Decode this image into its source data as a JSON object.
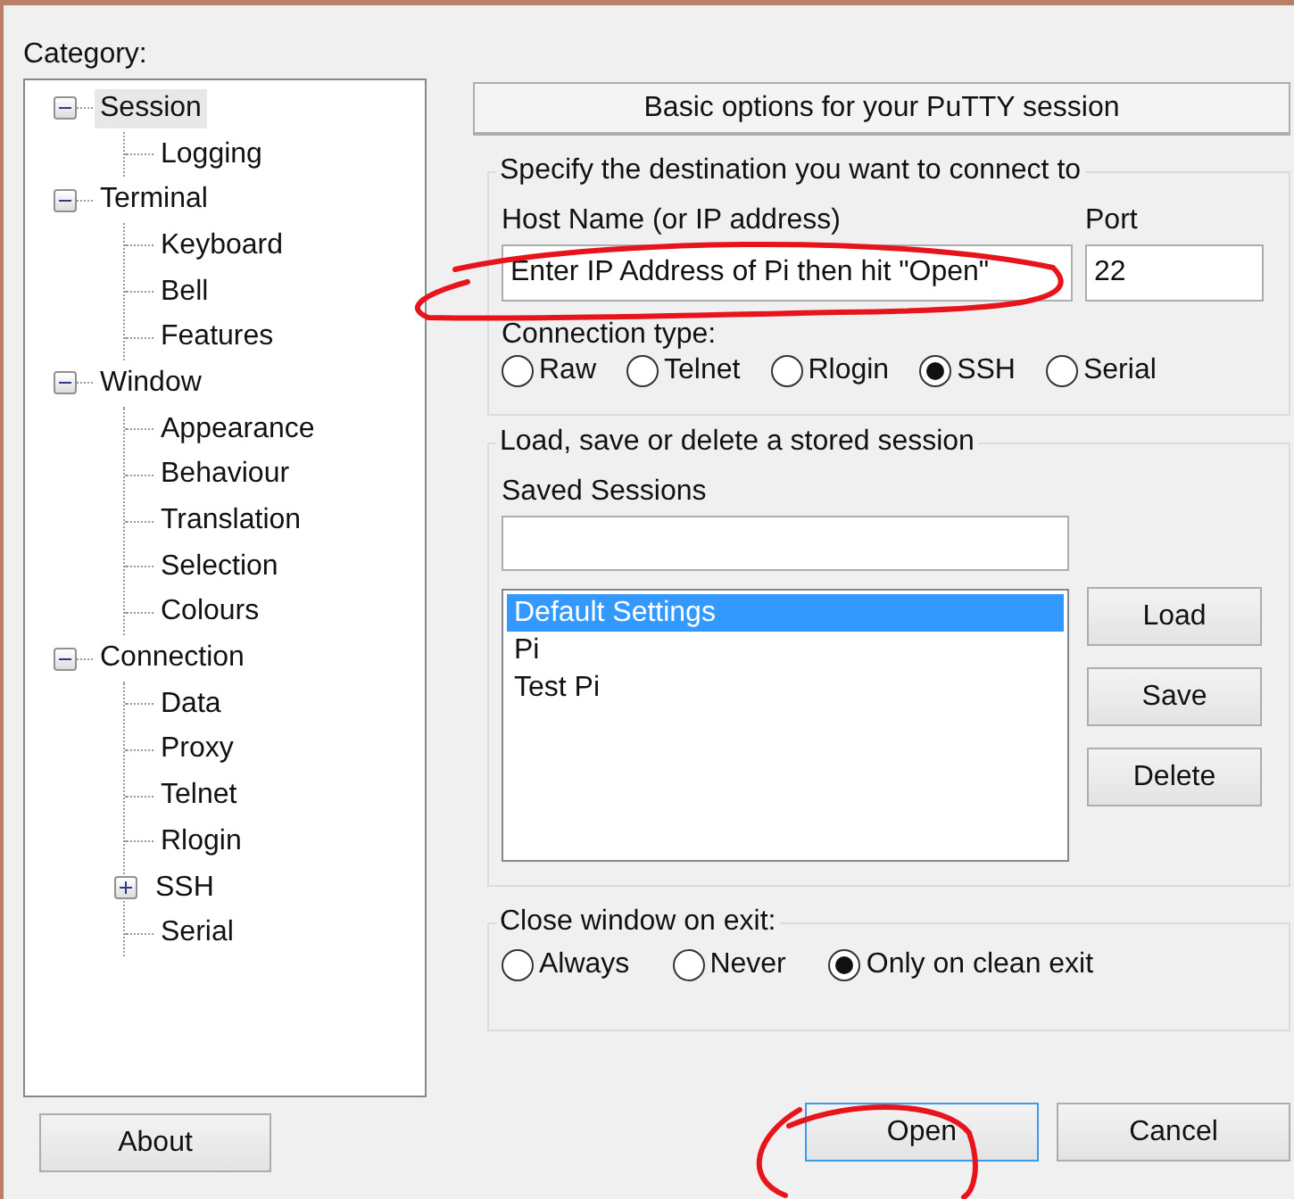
{
  "category_label": "Category:",
  "tree": [
    {
      "label": "Session",
      "expanded": true,
      "selected": true,
      "children": [
        {
          "label": "Logging",
          "selected": false
        }
      ]
    },
    {
      "label": "Terminal",
      "expanded": true,
      "selected": false,
      "children": [
        {
          "label": "Keyboard",
          "selected": false
        },
        {
          "label": "Bell",
          "selected": false
        },
        {
          "label": "Features",
          "selected": false
        }
      ]
    },
    {
      "label": "Window",
      "expanded": true,
      "selected": false,
      "children": [
        {
          "label": "Appearance",
          "selected": false
        },
        {
          "label": "Behaviour",
          "selected": false
        },
        {
          "label": "Translation",
          "selected": false
        },
        {
          "label": "Selection",
          "selected": false
        },
        {
          "label": "Colours",
          "selected": false
        }
      ]
    },
    {
      "label": "Connection",
      "expanded": true,
      "selected": false,
      "children": [
        {
          "label": "Data",
          "selected": false
        },
        {
          "label": "Proxy",
          "selected": false
        },
        {
          "label": "Telnet",
          "selected": false
        },
        {
          "label": "Rlogin",
          "selected": false
        },
        {
          "label": "SSH",
          "expanded": false,
          "selected": false
        },
        {
          "label": "Serial",
          "selected": false
        }
      ]
    }
  ],
  "header": "Basic options for your PuTTY session",
  "destination": {
    "legend": "Specify the destination you want to connect to",
    "host_label": "Host Name (or IP address)",
    "host_value": "Enter IP Address of Pi then hit \"Open\"",
    "port_label": "Port",
    "port_value": "22",
    "type_label": "Connection type:",
    "types": [
      {
        "label": "Raw",
        "selected": false
      },
      {
        "label": "Telnet",
        "selected": false
      },
      {
        "label": "Rlogin",
        "selected": false
      },
      {
        "label": "SSH",
        "selected": true
      },
      {
        "label": "Serial",
        "selected": false
      }
    ]
  },
  "sessions": {
    "legend": "Load, save or delete a stored session",
    "saved_label": "Saved Sessions",
    "items": [
      {
        "label": "Default Settings",
        "selected": true
      },
      {
        "label": "Pi",
        "selected": false
      },
      {
        "label": "Test Pi",
        "selected": false
      }
    ],
    "buttons": [
      "Load",
      "Save",
      "Delete"
    ]
  },
  "close_on_exit": {
    "legend": "Close window on exit:",
    "options": [
      {
        "label": "Always",
        "selected": false
      },
      {
        "label": "Never",
        "selected": false
      },
      {
        "label": "Only on clean exit",
        "selected": true
      }
    ]
  },
  "buttons": {
    "about": "About",
    "open": "Open",
    "cancel": "Cancel"
  }
}
